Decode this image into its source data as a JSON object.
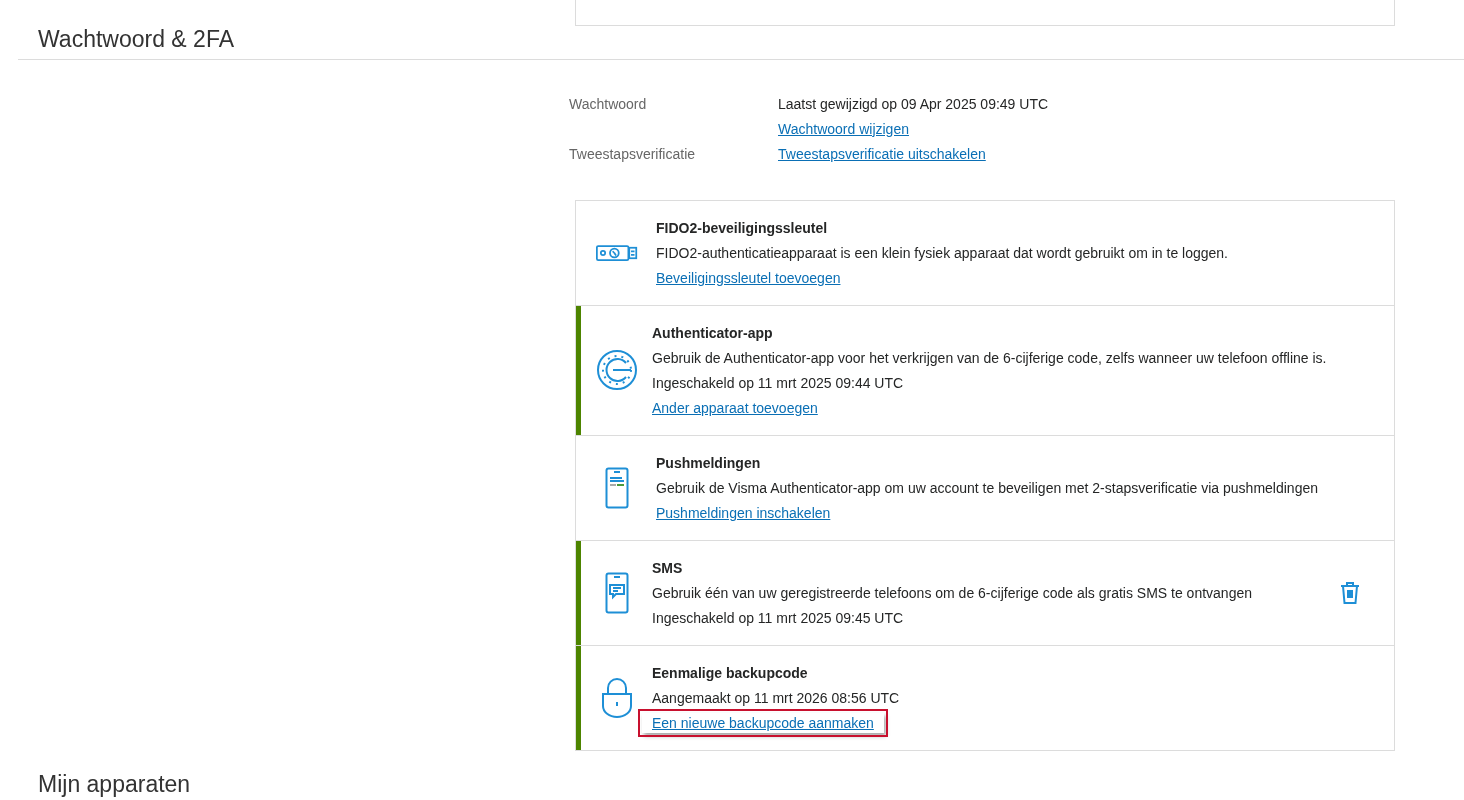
{
  "section_title": "Wachtwoord & 2FA",
  "info_rows": [
    {
      "label": "Wachtwoord",
      "value": "Laatst gewijzigd op 09 Apr 2025 09:49 UTC",
      "link": "Wachtwoord wijzigen"
    },
    {
      "label": "Tweestapsverificatie",
      "link": "Tweestapsverificatie uitschakelen"
    }
  ],
  "methods": [
    {
      "kind": "fido",
      "enabled": false,
      "title": "FIDO2-beveiligingssleutel",
      "description": "FIDO2-authenticatieapparaat is een klein fysiek apparaat dat wordt gebruikt om in te loggen.",
      "link": {
        "text": "Beveiligingssleutel toevoegen",
        "highlighted": false
      }
    },
    {
      "kind": "authenticator",
      "enabled": true,
      "title": "Authenticator-app",
      "description": "Gebruik de Authenticator-app voor het verkrijgen van de 6-cijferige code, zelfs wanneer uw telefoon offline is.",
      "status": "Ingeschakeld op 11 mrt 2025 09:44 UTC",
      "link": {
        "text": "Ander apparaat toevoegen",
        "highlighted": false
      }
    },
    {
      "kind": "push",
      "enabled": false,
      "title": "Pushmeldingen",
      "description": "Gebruik de Visma Authenticator-app om uw account te beveiligen met 2-stapsverificatie via pushmeldingen",
      "link": {
        "text": "Pushmeldingen inschakelen",
        "highlighted": false
      }
    },
    {
      "kind": "sms",
      "enabled": true,
      "title": "SMS",
      "description": "Gebruik één van uw geregistreerde telefoons om de 6-cijferige code als gratis SMS te ontvangen",
      "status": "Ingeschakeld op 11 mrt 2025 09:45 UTC",
      "deletable": true
    },
    {
      "kind": "backup",
      "enabled": true,
      "title": "Eenmalige backupcode",
      "status": "Aangemaakt op 11 mrt 2026 08:56 UTC",
      "link": {
        "text": "Een nieuwe backupcode aanmaken",
        "highlighted": true
      }
    }
  ],
  "next_section_title": "Mijn apparaten"
}
